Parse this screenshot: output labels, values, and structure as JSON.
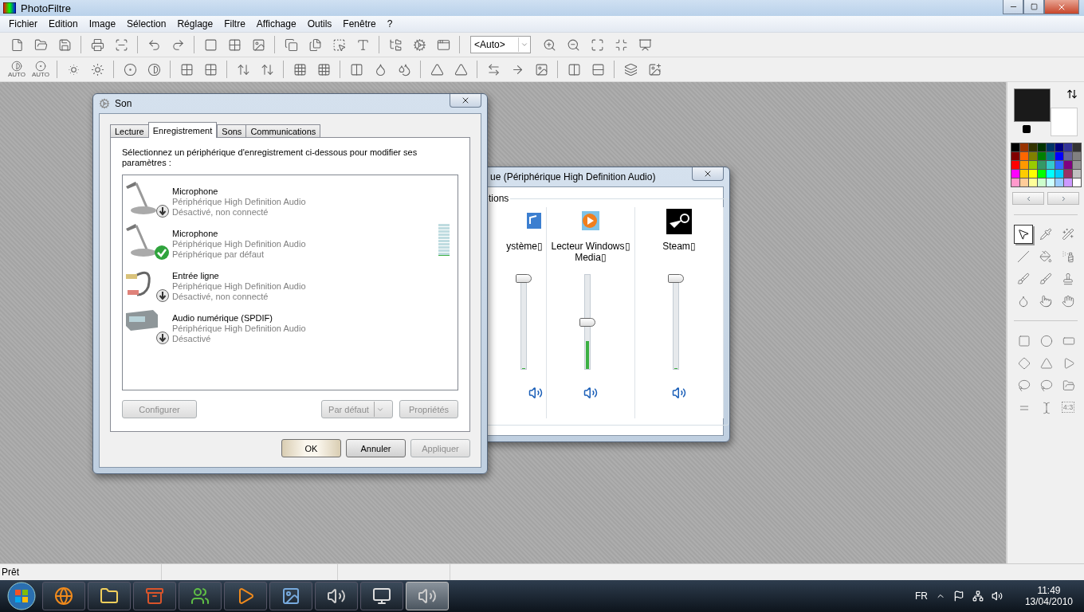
{
  "app": {
    "title": "PhotoFiltre"
  },
  "menu": [
    "Fichier",
    "Edition",
    "Image",
    "Sélection",
    "Réglage",
    "Filtre",
    "Affichage",
    "Outils",
    "Fenêtre",
    "?"
  ],
  "toolbar": {
    "zoom_select": {
      "value": "<Auto>"
    }
  },
  "toolbar2": {
    "auto_captions": [
      "AUTO",
      "AUTO"
    ]
  },
  "sound_dialog": {
    "title": "Son",
    "tabs": [
      {
        "label": "Lecture",
        "selected": false
      },
      {
        "label": "Enregistrement",
        "selected": true
      },
      {
        "label": "Sons",
        "selected": false
      },
      {
        "label": "Communications",
        "selected": false
      }
    ],
    "instruction": "Sélectionnez un périphérique d'enregistrement ci-dessous pour modifier ses paramètres :",
    "devices": [
      {
        "kind": "microphone",
        "name": "Microphone",
        "line1": "Périphérique High Definition Audio",
        "line2": "Désactivé, non connecté",
        "default": false
      },
      {
        "kind": "microphone",
        "name": "Microphone",
        "line1": "Périphérique High Definition Audio",
        "line2": "Périphérique par défaut",
        "default": true,
        "meter": {
          "level": 0
        }
      },
      {
        "kind": "line-in",
        "name": "Entrée ligne",
        "line1": "Périphérique High Definition Audio",
        "line2": "Désactivé, non connecté",
        "default": false
      },
      {
        "kind": "spdif",
        "name": "Audio numérique (SPDIF)",
        "line1": "Périphérique High Definition Audio",
        "line2": "Désactivé",
        "default": false
      }
    ],
    "list_buttons": [
      {
        "label": "Configurer",
        "disabled": true,
        "split": false
      },
      {
        "label": "Par défaut",
        "disabled": true,
        "split": true
      },
      {
        "label": "Propriétés",
        "disabled": true,
        "split": false
      }
    ],
    "buttons": [
      {
        "label": "OK",
        "disabled": false,
        "focused": true
      },
      {
        "label": "Annuler",
        "disabled": false,
        "focused": false
      },
      {
        "label": "Appliquer",
        "disabled": true,
        "focused": false
      }
    ]
  },
  "mixer_window": {
    "title": "ue (Périphérique High Definition Audio)",
    "group_label": "tions",
    "channels": [
      {
        "kind": "system",
        "name": "ystème▯",
        "volume": {
          "level": 1
        },
        "meter": {
          "level": 0
        }
      },
      {
        "kind": "media-player",
        "name": "Lecteur Windows▯ Media▯",
        "volume": {
          "level": 0.5
        },
        "meter": {
          "level": 0.3
        }
      },
      {
        "kind": "steam",
        "name": "Steam▯",
        "volume": {
          "level": 1
        },
        "meter": {
          "level": 0
        }
      }
    ]
  },
  "palette": {
    "colors": [
      {
        "color": "#000000"
      },
      {
        "color": "#993300"
      },
      {
        "color": "#333300"
      },
      {
        "color": "#003300"
      },
      {
        "color": "#003366"
      },
      {
        "color": "#000080"
      },
      {
        "color": "#333399"
      },
      {
        "color": "#333333"
      },
      {
        "color": "#800000"
      },
      {
        "color": "#ff6600"
      },
      {
        "color": "#808000"
      },
      {
        "color": "#008000"
      },
      {
        "color": "#008080"
      },
      {
        "color": "#0000ff"
      },
      {
        "color": "#666699"
      },
      {
        "color": "#808080"
      },
      {
        "color": "#ff0000"
      },
      {
        "color": "#ff9900"
      },
      {
        "color": "#99cc00"
      },
      {
        "color": "#339966"
      },
      {
        "color": "#33cccc"
      },
      {
        "color": "#3366ff"
      },
      {
        "color": "#800080"
      },
      {
        "color": "#969696"
      },
      {
        "color": "#ff00ff"
      },
      {
        "color": "#ffcc00"
      },
      {
        "color": "#ffff00"
      },
      {
        "color": "#00ff00"
      },
      {
        "color": "#00ffff"
      },
      {
        "color": "#00ccff"
      },
      {
        "color": "#993366"
      },
      {
        "color": "#c0c0c0"
      },
      {
        "color": "#ff99cc"
      },
      {
        "color": "#ffcc99"
      },
      {
        "color": "#ffff99"
      },
      {
        "color": "#ccffcc"
      },
      {
        "color": "#ccffff"
      },
      {
        "color": "#99ccff"
      },
      {
        "color": "#cc99ff"
      },
      {
        "color": "#ffffff"
      }
    ]
  },
  "tools": [
    {
      "kind": "pointer",
      "selected": true
    },
    {
      "kind": "pipette",
      "selected": false
    },
    {
      "kind": "wand",
      "selected": false
    },
    {
      "kind": "line",
      "selected": false
    },
    {
      "kind": "bucket",
      "selected": false
    },
    {
      "kind": "spray",
      "selected": false
    },
    {
      "kind": "brush",
      "selected": false
    },
    {
      "kind": "brush-plus",
      "selected": false
    },
    {
      "kind": "stamp",
      "selected": false
    },
    {
      "kind": "drop",
      "selected": false
    },
    {
      "kind": "finger",
      "selected": false
    },
    {
      "kind": "hand",
      "selected": false
    }
  ],
  "shapes": [
    {
      "kind": "rectangle"
    },
    {
      "kind": "ellipse"
    },
    {
      "kind": "rounded"
    },
    {
      "kind": "diamond"
    },
    {
      "kind": "triangle"
    },
    {
      "kind": "arrow"
    },
    {
      "kind": "lasso"
    },
    {
      "kind": "polygon-lasso"
    },
    {
      "kind": "folder"
    },
    {
      "kind": "equal"
    },
    {
      "kind": "text-cursor"
    },
    {
      "kind": "ratio",
      "label": "4:3"
    }
  ],
  "status_bar": [
    "Prêt"
  ],
  "taskbar": {
    "apps": [
      {
        "kind": "browser",
        "selected": false
      },
      {
        "kind": "folder",
        "selected": false
      },
      {
        "kind": "archive",
        "selected": false
      },
      {
        "kind": "messenger",
        "selected": false
      },
      {
        "kind": "media",
        "selected": false
      },
      {
        "kind": "photo",
        "selected": false
      },
      {
        "kind": "speaker",
        "selected": false
      },
      {
        "kind": "monitor",
        "selected": false
      },
      {
        "kind": "speaker",
        "selected": true
      }
    ],
    "language": "FR",
    "time": "11:49",
    "date": "13/04/2010"
  }
}
